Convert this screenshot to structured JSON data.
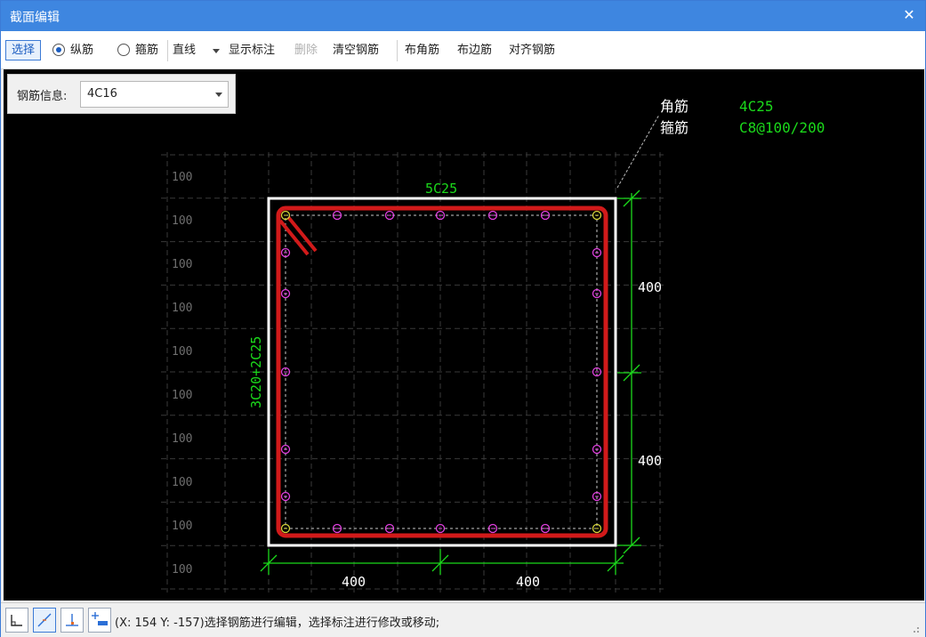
{
  "window": {
    "title": "截面编辑",
    "close_icon": "close-icon"
  },
  "toolbar": {
    "select_label": "选择",
    "radio_longitudinal": "纵筋",
    "radio_stirrup": "箍筋",
    "line_type": "直线",
    "show_annotation": "显示标注",
    "delete": "删除",
    "clear_rebar": "清空钢筋",
    "place_corner": "布角筋",
    "place_edge": "布边筋",
    "align_rebar": "对齐钢筋"
  },
  "info": {
    "label": "钢筋信息:",
    "value": "4C16"
  },
  "drawing": {
    "grid_label": "100",
    "grid_label_count": 10,
    "top_label": "5C25",
    "side_label": "3C20+2C25",
    "dim_right": [
      "400",
      "400"
    ],
    "dim_bottom": [
      "400",
      "400"
    ],
    "legend": [
      {
        "name": "角筋",
        "value": "4C25"
      },
      {
        "name": "箍筋",
        "value": "C8@100/200"
      }
    ],
    "colors": {
      "rebar_pink": "#e23fe0",
      "rebar_yellow": "#d6d43a",
      "stirrup_red": "#d11a1a",
      "dim_green": "#1bd91b",
      "section_white": "#ffffff"
    }
  },
  "status": {
    "text": "(X: 154 Y: -157)选择钢筋进行编辑，选择标注进行修改或移动;"
  }
}
